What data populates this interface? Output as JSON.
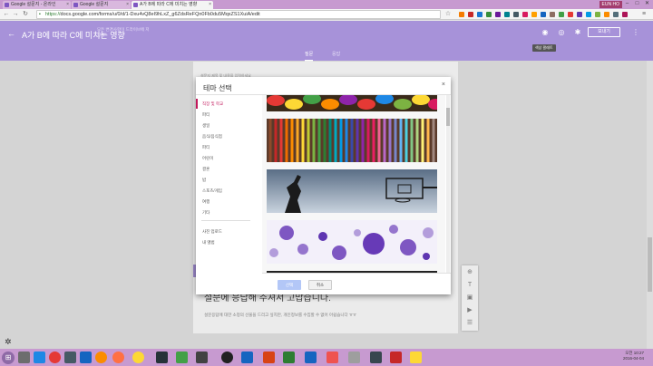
{
  "browser": {
    "tabs": [
      {
        "label": "Google 설문지 - 온라인"
      },
      {
        "label": "Google 설문지"
      },
      {
        "label": "A가 B에 따라 C에 미치는 영향"
      }
    ],
    "user_chip": "EUN HO",
    "window_controls": [
      "–",
      "□",
      "✕"
    ],
    "url_scheme": "https://",
    "url_rest": "docs.google.com/forms/u/0/d/1-Dxu4vQ8eI9hLxZ_g6ZdsReFQn0Fb0du5MqxZS1XuiA/edit"
  },
  "form_header": {
    "title": "A가 B에 따라 C에 미치는 영향",
    "subtitle": "모든 변경사항이 드라이브에 저장됨",
    "send_label": "보내기",
    "tooltip": "색상 팔레트",
    "tabs": [
      {
        "label": "질문"
      },
      {
        "label": "응답"
      }
    ]
  },
  "form_body": {
    "card_top_text": "설문지 제목 및 내용을 입력하세요",
    "big_text": "설문에 응답해 주셔서 고맙습니다.",
    "description": "설문응답에 대한 소정의 선물을 드리고 싶지만, 개인정보를 수집할 수 없어 아쉽습니다 ㅠㅠ"
  },
  "theme_dialog": {
    "title": "테마 선택",
    "close": "×",
    "categories": [
      {
        "label": "직장 및 학교",
        "active": true
      },
      {
        "label": "파티"
      },
      {
        "label": "생일"
      },
      {
        "label": "음식/음식점"
      },
      {
        "label": "파티"
      },
      {
        "label": "어린이"
      },
      {
        "label": "결혼"
      },
      {
        "label": "밤"
      },
      {
        "label": "스포츠/게임"
      },
      {
        "label": "여행"
      },
      {
        "label": "기타"
      }
    ],
    "extra_options": [
      {
        "label": "사진 업로드"
      },
      {
        "label": "내 앨범"
      }
    ],
    "select_label": "선택",
    "cancel_label": "취소"
  },
  "taskbar": {
    "time": "오전 10:27",
    "date": "2016-04-04"
  },
  "colors": {
    "header_purple": "#a792d9",
    "tab_strip": "#c79ad0",
    "accent_pink": "#c2185b"
  }
}
